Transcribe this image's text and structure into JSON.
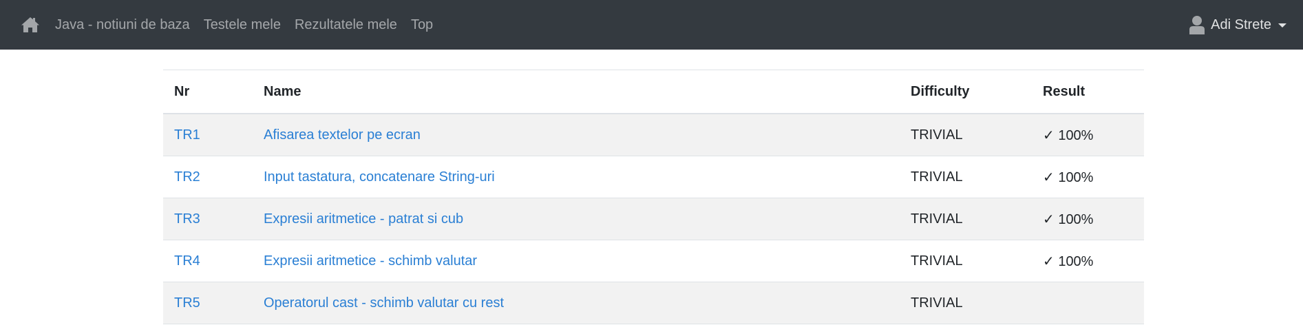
{
  "navbar": {
    "home_icon": "home-icon",
    "links": [
      {
        "label": "Java - notiuni de baza"
      },
      {
        "label": "Testele mele"
      },
      {
        "label": "Rezultatele mele"
      },
      {
        "label": "Top"
      }
    ],
    "user": {
      "icon": "user-icon",
      "name": "Adi Strete"
    }
  },
  "table": {
    "headers": {
      "nr": "Nr",
      "name": "Name",
      "difficulty": "Difficulty",
      "result": "Result"
    },
    "rows": [
      {
        "nr": "TR1",
        "name": "Afisarea textelor pe ecran",
        "difficulty": "TRIVIAL",
        "result": "✓ 100%"
      },
      {
        "nr": "TR2",
        "name": "Input tastatura, concatenare String-uri",
        "difficulty": "TRIVIAL",
        "result": "✓ 100%"
      },
      {
        "nr": "TR3",
        "name": "Expresii aritmetice - patrat si cub",
        "difficulty": "TRIVIAL",
        "result": "✓ 100%"
      },
      {
        "nr": "TR4",
        "name": "Expresii aritmetice - schimb valutar",
        "difficulty": "TRIVIAL",
        "result": "✓ 100%"
      },
      {
        "nr": "TR5",
        "name": "Operatorul cast - schimb valutar cu rest",
        "difficulty": "TRIVIAL",
        "result": ""
      }
    ]
  },
  "colors": {
    "navbar_bg": "#343a40",
    "link": "#2a7fd4",
    "stripe": "#f2f2f2"
  }
}
